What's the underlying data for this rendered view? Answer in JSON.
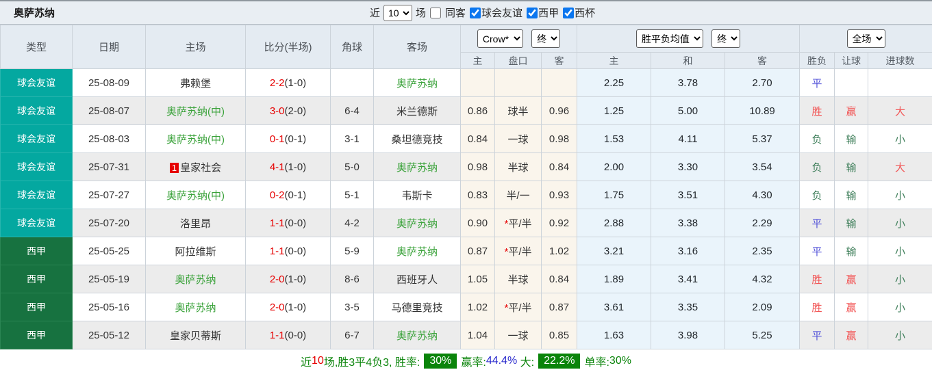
{
  "colors": {
    "friendly_teal": "#04a8a0",
    "liga_green": "#177240",
    "self_team_green": "#3aa23a",
    "score_red": "#e60000",
    "win_red": "#f25555",
    "draw_blue": "#5151d8",
    "lose_green": "#3c7d58",
    "handicap_cell_bg": "#faf5ec",
    "odds_cell_bg": "#eaf4fb",
    "footer_green": "#0a840a",
    "checkbox_blue": "#0b76ef"
  },
  "topbar": {
    "title": "奥萨苏纳",
    "recent_label": "近",
    "recent_value": "10",
    "matches_label": "场",
    "same_venue_label": "同客",
    "filters": [
      {
        "label": "球会友谊",
        "checked": true
      },
      {
        "label": "西甲",
        "checked": true
      },
      {
        "label": "西杯",
        "checked": true
      }
    ]
  },
  "table": {
    "headers": {
      "type": "类型",
      "date": "日期",
      "home": "主场",
      "score": "比分(半场)",
      "corner": "角球",
      "away": "客场",
      "crow_select": "Crow*",
      "crow_state_select": "终",
      "odds_select": "胜平负均值",
      "odds_state_select": "终",
      "full_select": "全场",
      "sub": [
        "主",
        "盘口",
        "客",
        "主",
        "和",
        "客",
        "胜负",
        "让球",
        "进球数"
      ]
    },
    "rows": [
      {
        "league": "球会友谊",
        "kind": "friendly",
        "date": "25-08-09",
        "badge": "",
        "home": "弗赖堡",
        "home_self": false,
        "score": "2-2",
        "half": "(1-0)",
        "corner": "",
        "away": "奥萨苏纳",
        "away_self": true,
        "ah_h": "",
        "ah_star": false,
        "ah": "",
        "ah_a": "",
        "o_h": "2.25",
        "o_d": "3.78",
        "o_a": "2.70",
        "res": "平",
        "res_c": "blue",
        "hres": "",
        "hres_c": "",
        "goal": "",
        "goal_c": ""
      },
      {
        "league": "球会友谊",
        "kind": "friendly",
        "date": "25-08-07",
        "badge": "",
        "home": "奥萨苏纳(中)",
        "home_self": true,
        "score": "3-0",
        "half": "(2-0)",
        "corner": "6-4",
        "away": "米兰德斯",
        "away_self": false,
        "ah_h": "0.86",
        "ah_star": false,
        "ah": "球半",
        "ah_a": "0.96",
        "o_h": "1.25",
        "o_d": "5.00",
        "o_a": "10.89",
        "res": "胜",
        "res_c": "red",
        "hres": "赢",
        "hres_c": "red",
        "goal": "大",
        "goal_c": "red"
      },
      {
        "league": "球会友谊",
        "kind": "friendly",
        "date": "25-08-03",
        "badge": "",
        "home": "奥萨苏纳(中)",
        "home_self": true,
        "score": "0-1",
        "half": "(0-1)",
        "corner": "3-1",
        "away": "桑坦德竞技",
        "away_self": false,
        "ah_h": "0.84",
        "ah_star": false,
        "ah": "一球",
        "ah_a": "0.98",
        "o_h": "1.53",
        "o_d": "4.11",
        "o_a": "5.37",
        "res": "负",
        "res_c": "green",
        "hres": "输",
        "hres_c": "green",
        "goal": "小",
        "goal_c": "green"
      },
      {
        "league": "球会友谊",
        "kind": "friendly",
        "date": "25-07-31",
        "badge": "1",
        "home": "皇家社会",
        "home_self": false,
        "score": "4-1",
        "half": "(1-0)",
        "corner": "5-0",
        "away": "奥萨苏纳",
        "away_self": true,
        "ah_h": "0.98",
        "ah_star": false,
        "ah": "半球",
        "ah_a": "0.84",
        "o_h": "2.00",
        "o_d": "3.30",
        "o_a": "3.54",
        "res": "负",
        "res_c": "green",
        "hres": "输",
        "hres_c": "green",
        "goal": "大",
        "goal_c": "red"
      },
      {
        "league": "球会友谊",
        "kind": "friendly",
        "date": "25-07-27",
        "badge": "",
        "home": "奥萨苏纳(中)",
        "home_self": true,
        "score": "0-2",
        "half": "(0-1)",
        "corner": "5-1",
        "away": "韦斯卡",
        "away_self": false,
        "ah_h": "0.83",
        "ah_star": false,
        "ah": "半/一",
        "ah_a": "0.93",
        "o_h": "1.75",
        "o_d": "3.51",
        "o_a": "4.30",
        "res": "负",
        "res_c": "green",
        "hres": "输",
        "hres_c": "green",
        "goal": "小",
        "goal_c": "green"
      },
      {
        "league": "球会友谊",
        "kind": "friendly",
        "date": "25-07-20",
        "badge": "",
        "home": "洛里昂",
        "home_self": false,
        "score": "1-1",
        "half": "(0-0)",
        "corner": "4-2",
        "away": "奥萨苏纳",
        "away_self": true,
        "ah_h": "0.90",
        "ah_star": true,
        "ah": "平/半",
        "ah_a": "0.92",
        "o_h": "2.88",
        "o_d": "3.38",
        "o_a": "2.29",
        "res": "平",
        "res_c": "blue",
        "hres": "输",
        "hres_c": "green",
        "goal": "小",
        "goal_c": "green"
      },
      {
        "league": "西甲",
        "kind": "liga",
        "date": "25-05-25",
        "badge": "",
        "home": "阿拉维斯",
        "home_self": false,
        "score": "1-1",
        "half": "(0-0)",
        "corner": "5-9",
        "away": "奥萨苏纳",
        "away_self": true,
        "ah_h": "0.87",
        "ah_star": true,
        "ah": "平/半",
        "ah_a": "1.02",
        "o_h": "3.21",
        "o_d": "3.16",
        "o_a": "2.35",
        "res": "平",
        "res_c": "blue",
        "hres": "输",
        "hres_c": "green",
        "goal": "小",
        "goal_c": "green"
      },
      {
        "league": "西甲",
        "kind": "liga",
        "date": "25-05-19",
        "badge": "",
        "home": "奥萨苏纳",
        "home_self": true,
        "score": "2-0",
        "half": "(1-0)",
        "corner": "8-6",
        "away": "西班牙人",
        "away_self": false,
        "ah_h": "1.05",
        "ah_star": false,
        "ah": "半球",
        "ah_a": "0.84",
        "o_h": "1.89",
        "o_d": "3.41",
        "o_a": "4.32",
        "res": "胜",
        "res_c": "red",
        "hres": "赢",
        "hres_c": "red",
        "goal": "小",
        "goal_c": "green"
      },
      {
        "league": "西甲",
        "kind": "liga",
        "date": "25-05-16",
        "badge": "",
        "home": "奥萨苏纳",
        "home_self": true,
        "score": "2-0",
        "half": "(1-0)",
        "corner": "3-5",
        "away": "马德里竞技",
        "away_self": false,
        "ah_h": "1.02",
        "ah_star": true,
        "ah": "平/半",
        "ah_a": "0.87",
        "o_h": "3.61",
        "o_d": "3.35",
        "o_a": "2.09",
        "res": "胜",
        "res_c": "red",
        "hres": "赢",
        "hres_c": "red",
        "goal": "小",
        "goal_c": "green"
      },
      {
        "league": "西甲",
        "kind": "liga",
        "date": "25-05-12",
        "badge": "",
        "home": "皇家贝蒂斯",
        "home_self": false,
        "score": "1-1",
        "half": "(0-0)",
        "corner": "6-7",
        "away": "奥萨苏纳",
        "away_self": true,
        "ah_h": "1.04",
        "ah_star": false,
        "ah": "一球",
        "ah_a": "0.85",
        "o_h": "1.63",
        "o_d": "3.98",
        "o_a": "5.25",
        "res": "平",
        "res_c": "blue",
        "hres": "赢",
        "hres_c": "red",
        "goal": "小",
        "goal_c": "green"
      }
    ]
  },
  "footer": {
    "jin": "近",
    "count": "10",
    "stats": "场,胜3平4负3, 胜率:",
    "win_rate": "30%",
    "ying_label": "赢率:",
    "ying_value": "44.4%",
    "da_label": " 大:",
    "da_value": "22.2%",
    "dan_label": "单率:",
    "dan_value": "30%"
  }
}
